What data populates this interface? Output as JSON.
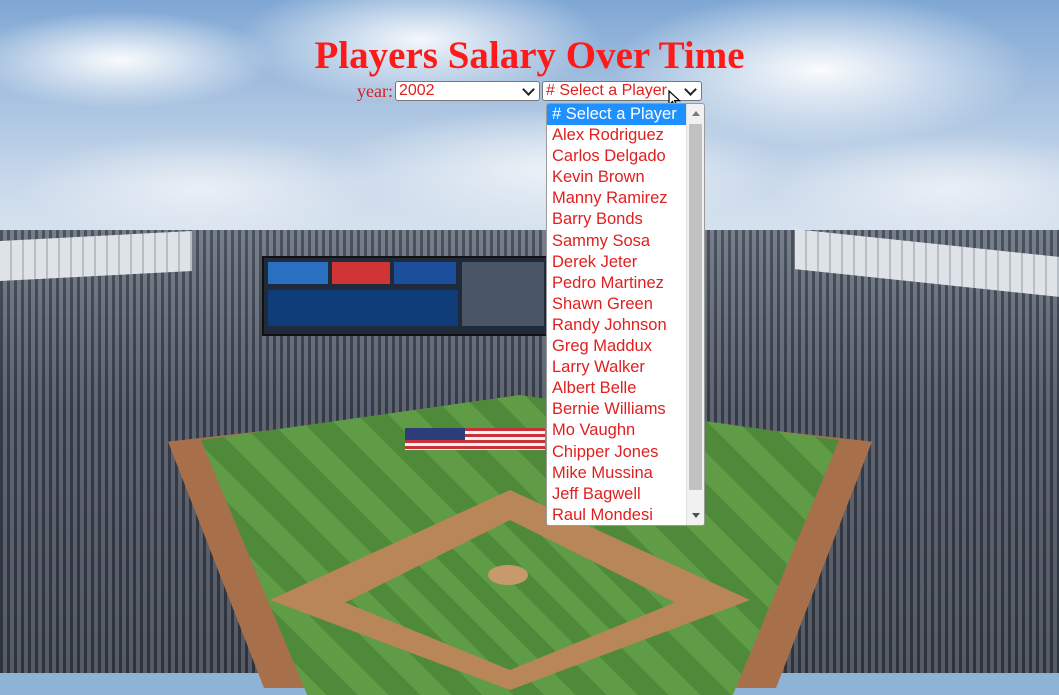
{
  "page": {
    "title": "Players Salary Over Time"
  },
  "controls": {
    "year_label": "year:",
    "year_selected": "2002",
    "player_selected": "# Select a Player"
  },
  "dropdown": {
    "options": [
      "# Select a Player",
      "Alex Rodriguez",
      "Carlos Delgado",
      "Kevin Brown",
      "Manny Ramirez",
      "Barry Bonds",
      "Sammy Sosa",
      "Derek Jeter",
      "Pedro Martinez",
      "Shawn Green",
      "Randy Johnson",
      "Greg Maddux",
      "Larry Walker",
      "Albert Belle",
      "Bernie Williams",
      "Mo Vaughn",
      "Chipper Jones",
      "Mike Mussina",
      "Jeff Bagwell",
      "Raul Mondesi"
    ],
    "highlighted_index": 0
  },
  "colors": {
    "title": "#ff1a1a",
    "text": "#e02020",
    "highlight": "#1e90ff"
  },
  "icons": {
    "cursor": "mouse-pointer-icon",
    "select_chevron": "chevron-down-icon"
  }
}
